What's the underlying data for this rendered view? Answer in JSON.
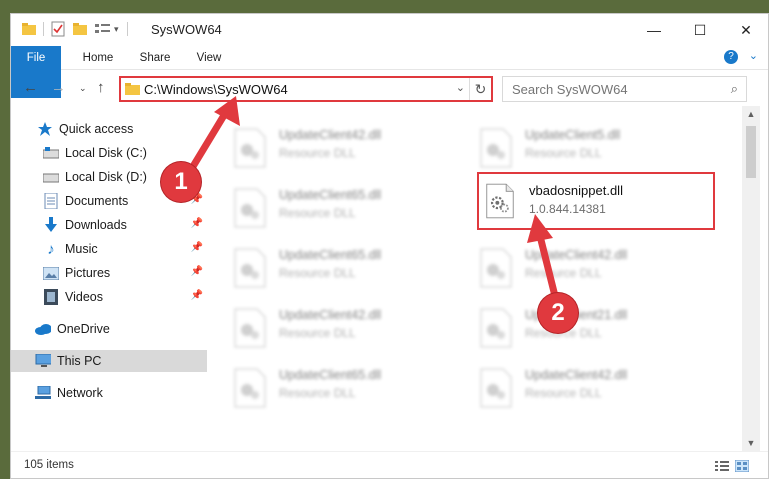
{
  "window": {
    "title": "SysWOW64",
    "minimize_glyph": "—",
    "maximize_glyph": "☐",
    "close_glyph": "✕"
  },
  "ribbon": {
    "tabs": [
      "File",
      "Home",
      "Share",
      "View"
    ]
  },
  "address": {
    "path": "C:\\Windows\\SysWOW64"
  },
  "search": {
    "placeholder": "Search SysWOW64"
  },
  "sidebar": {
    "items": [
      {
        "label": "Quick access",
        "icon": "star-icon"
      },
      {
        "label": "Local Disk (C:)",
        "icon": "drive-icon"
      },
      {
        "label": "Local Disk (D:)",
        "icon": "drive-icon"
      },
      {
        "label": "Documents",
        "icon": "documents-icon"
      },
      {
        "label": "Downloads",
        "icon": "download-icon"
      },
      {
        "label": "Music",
        "icon": "music-icon"
      },
      {
        "label": "Pictures",
        "icon": "pictures-icon"
      },
      {
        "label": "Videos",
        "icon": "videos-icon"
      },
      {
        "label": "OneDrive",
        "icon": "cloud-icon"
      },
      {
        "label": "This PC",
        "icon": "computer-icon"
      },
      {
        "label": "Network",
        "icon": "network-icon"
      }
    ],
    "selected": "This PC"
  },
  "files": {
    "highlighted": {
      "name": "vbadosnippet.dll",
      "detail": "1.0.844.14381"
    },
    "background": [
      {
        "name": "UpdateClient42.dll",
        "detail": "Resource DLL"
      },
      {
        "name": "UpdateClient5.dll",
        "detail": "Resource DLL"
      },
      {
        "name": "UpdateClient65.dll",
        "detail": "Resource DLL"
      },
      {
        "name": "UpdateClient65.dll",
        "detail": "Resource DLL"
      },
      {
        "name": "UpdateClient42.dll",
        "detail": "Resource DLL"
      },
      {
        "name": "UpdateClient42.dll",
        "detail": "Resource DLL"
      },
      {
        "name": "UpdateClient21.dll",
        "detail": "Resource DLL"
      },
      {
        "name": "UpdateClient65.dll",
        "detail": "Resource DLL"
      },
      {
        "name": "UpdateClient42.dll",
        "detail": "Resource DLL"
      }
    ]
  },
  "status": {
    "count": "105 items"
  },
  "callouts": {
    "first": "1",
    "second": "2"
  },
  "colors": {
    "accent": "#1979ca",
    "highlight": "#e0393e",
    "selected_bg": "#d9d9d9"
  }
}
